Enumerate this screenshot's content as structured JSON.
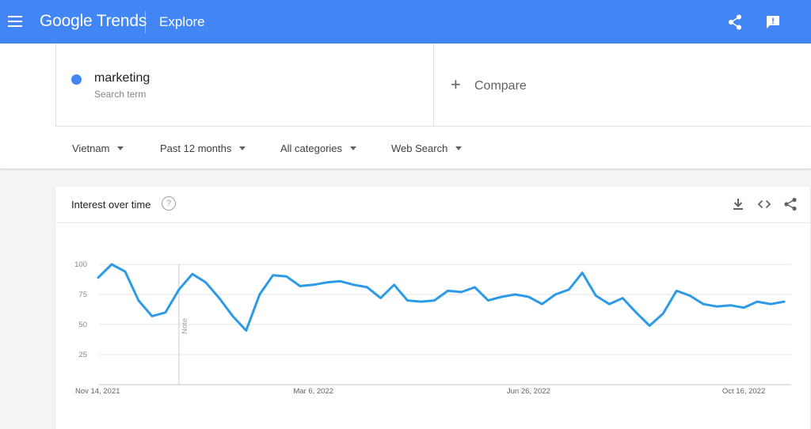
{
  "header": {
    "logo_text": "Google Trends",
    "section_title": "Explore",
    "menu_icon": "hamburger-menu-icon",
    "share_icon": "share-icon",
    "feedback_icon": "feedback-icon",
    "bar_color": "#4285f4"
  },
  "search": {
    "term": "marketing",
    "term_subtitle": "Search term",
    "term_color": "#4285f4",
    "compare_label": "Compare"
  },
  "filters": {
    "region": "Vietnam",
    "time_range": "Past 12 months",
    "category": "All categories",
    "search_type": "Web Search"
  },
  "interest_card": {
    "title": "Interest over time",
    "help_icon": "question-icon",
    "download_icon": "download-icon",
    "embed_icon": "embed-code-icon",
    "share_icon": "share-icon"
  },
  "chart_data": {
    "type": "line",
    "series": [
      {
        "name": "marketing",
        "color": "#2d9ae8",
        "values": [
          89,
          100,
          94,
          70,
          57,
          60,
          79,
          92,
          85,
          72,
          57,
          45,
          75,
          91,
          90,
          82,
          83,
          85,
          86,
          83,
          81,
          72,
          83,
          70,
          69,
          70,
          78,
          77,
          81,
          70,
          73,
          75,
          73,
          67,
          75,
          79,
          93,
          74,
          67,
          72,
          60,
          49,
          59,
          78,
          74,
          67,
          65,
          66,
          64,
          69,
          67,
          69
        ]
      }
    ],
    "ylim": [
      0,
      100
    ],
    "yticks": [
      25,
      50,
      75,
      100
    ],
    "x_tick_labels": [
      "Nov 14, 2021",
      "Mar 6, 2022",
      "Jun 26, 2022",
      "Oct 16, 2022"
    ],
    "x_tick_indices": [
      0,
      16,
      32,
      48
    ],
    "annotation": {
      "label": "Note",
      "index": 6
    },
    "grid": true
  }
}
